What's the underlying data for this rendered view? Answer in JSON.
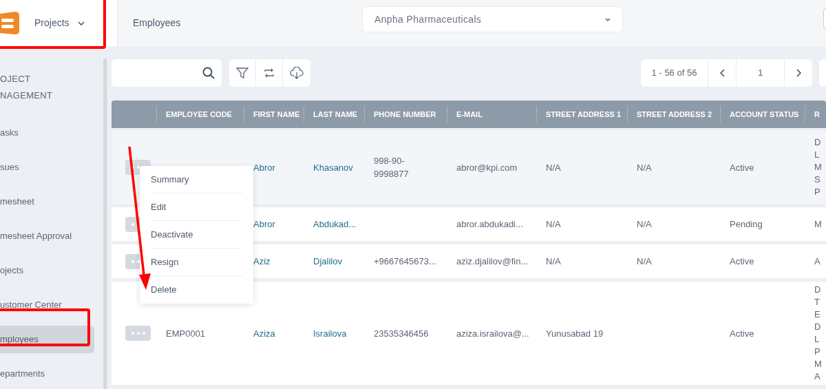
{
  "header": {
    "module": "Projects",
    "page_title": "Employees",
    "company_select": {
      "value": "Anpha Pharmaceuticals"
    }
  },
  "sidebar": {
    "section": "OJECT\nNAGEMENT",
    "items": [
      {
        "label": "asks",
        "selected": false
      },
      {
        "label": "sues",
        "selected": false
      },
      {
        "label": "mesheet",
        "selected": false
      },
      {
        "label": "mesheet Approval",
        "selected": false
      },
      {
        "label": "ojects",
        "selected": false
      },
      {
        "label": "ustomer Center",
        "selected": false
      },
      {
        "label": "mployees",
        "selected": true
      },
      {
        "label": "epartments",
        "selected": false
      }
    ]
  },
  "toolbar": {
    "pagination": {
      "range": "1 - 56 of 56",
      "page": "1"
    }
  },
  "table": {
    "columns": [
      "EMPLOYEE CODE",
      "FIRST NAME",
      "LAST NAME",
      "PHONE NUMBER",
      "E-MAIL",
      "STREET ADDRESS 1",
      "STREET ADDRESS 2",
      "ACCOUNT STATUS",
      "R"
    ],
    "rows": [
      {
        "cells": [
          "",
          "Abror",
          "Khasanov",
          "998-90-\n9998877",
          "abror@kpi.com",
          "N/A",
          "N/A",
          "Active",
          "D\nL\nM\nS\nP"
        ],
        "highlighted": true
      },
      {
        "cells": [
          "",
          "Abror",
          "Abdukad...",
          "",
          "abror.abdukadi...",
          "N/A",
          "N/A",
          "Pending",
          "M"
        ],
        "highlighted": false
      },
      {
        "cells": [
          "",
          "Aziz",
          "Djalilov",
          "+9667645673...",
          "aziz.djalilov@fin...",
          "N/A",
          "N/A",
          "Active",
          "A"
        ],
        "highlighted": false
      },
      {
        "cells": [
          "EMP0001",
          "Aziza",
          "Israilova",
          "23535346456",
          "aziza.israilova@...",
          "Yunusabad 19",
          "",
          "Active",
          "D\nT\nE\nD\nL\nP\nM\nA"
        ],
        "highlighted": false
      }
    ]
  },
  "context_menu": {
    "items": [
      "Summary",
      "Edit",
      "Deactivate",
      "Resign",
      "Delete"
    ]
  },
  "annotations": [
    {
      "kind": "box"
    },
    {
      "kind": "box"
    },
    {
      "kind": "arrow"
    }
  ]
}
